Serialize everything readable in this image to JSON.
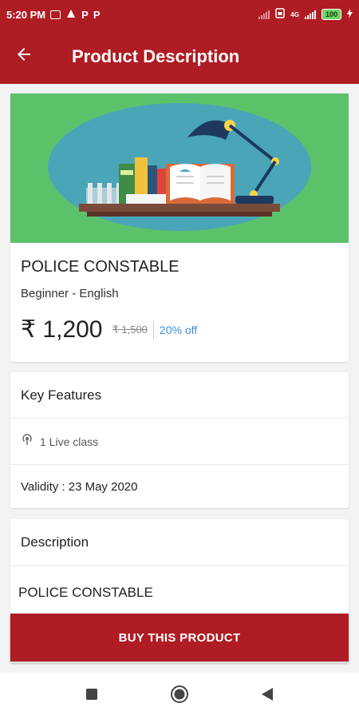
{
  "status_bar": {
    "time": "5:20 PM",
    "icons_left": [
      "mail-icon",
      "app-icon",
      "p-icon",
      "p-icon"
    ],
    "p_letter": "P",
    "network_label": "4G",
    "battery": "100"
  },
  "app_bar": {
    "title": "Product Description",
    "back_icon": "arrow-left-icon",
    "background": "#b01c24"
  },
  "product": {
    "name": "POLICE CONSTABLE",
    "level": "Beginner - English",
    "price": "₹ 1,200",
    "original_price": "₹ 1,500",
    "discount": "20% off",
    "banner_icon": "books-lamp-illustration"
  },
  "features": {
    "title": "Key Features",
    "live_class": "1 Live class",
    "live_icon": "broadcast-icon",
    "validity": "Validity : 23 May 2020"
  },
  "description": {
    "title": "Description",
    "text": "POLICE CONSTABLE"
  },
  "buy_button": {
    "label": "BUY THIS PRODUCT"
  },
  "colors": {
    "accent": "#b01c24",
    "discount": "#3b8ed6",
    "banner_bg": "#5cc26a"
  }
}
